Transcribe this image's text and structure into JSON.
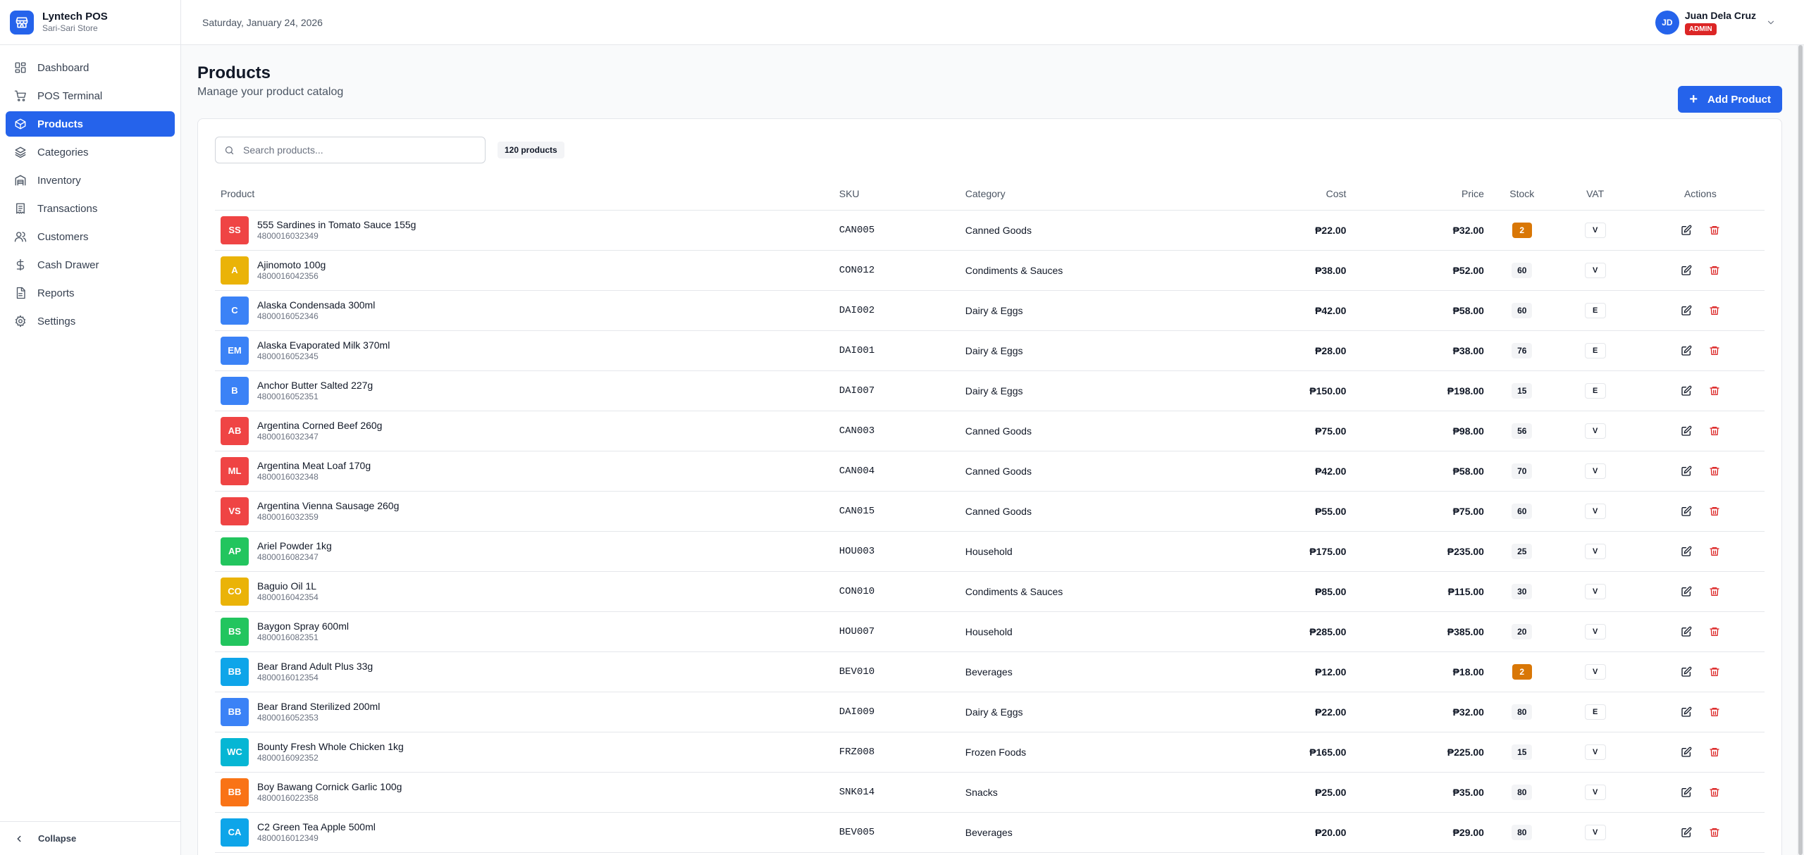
{
  "app": {
    "name": "Lyntech POS",
    "store": "Sari-Sari Store"
  },
  "header": {
    "date": "Saturday, January 24, 2026",
    "user": {
      "initials": "JD",
      "name": "Juan Dela Cruz",
      "role": "ADMIN"
    }
  },
  "sidebar": {
    "items": [
      {
        "label": "Dashboard",
        "icon": "dashboard-icon",
        "active": false
      },
      {
        "label": "POS Terminal",
        "icon": "cart-icon",
        "active": false
      },
      {
        "label": "Products",
        "icon": "package-icon",
        "active": true
      },
      {
        "label": "Categories",
        "icon": "layers-icon",
        "active": false
      },
      {
        "label": "Inventory",
        "icon": "warehouse-icon",
        "active": false
      },
      {
        "label": "Transactions",
        "icon": "receipt-icon",
        "active": false
      },
      {
        "label": "Customers",
        "icon": "users-icon",
        "active": false
      },
      {
        "label": "Cash Drawer",
        "icon": "dollar-icon",
        "active": false
      },
      {
        "label": "Reports",
        "icon": "report-icon",
        "active": false
      },
      {
        "label": "Settings",
        "icon": "gear-icon",
        "active": false
      }
    ],
    "collapse_label": "Collapse"
  },
  "page": {
    "title": "Products",
    "subtitle": "Manage your product catalog",
    "add_button": "Add Product"
  },
  "search": {
    "placeholder": "Search products..."
  },
  "product_count": "120 products",
  "table": {
    "columns": [
      "Product",
      "SKU",
      "Category",
      "Cost",
      "Price",
      "Stock",
      "VAT",
      "Actions"
    ],
    "rows": [
      {
        "initials": "SS",
        "color": "#ef4444",
        "name": "555 Sardines in Tomato Sauce 155g",
        "barcode": "4800016032349",
        "sku": "CAN005",
        "category": "Canned Goods",
        "cost": "₱22.00",
        "price": "₱32.00",
        "stock": "2",
        "low": true,
        "vat": "V"
      },
      {
        "initials": "A",
        "color": "#eab308",
        "name": "Ajinomoto 100g",
        "barcode": "4800016042356",
        "sku": "CON012",
        "category": "Condiments & Sauces",
        "cost": "₱38.00",
        "price": "₱52.00",
        "stock": "60",
        "low": false,
        "vat": "V"
      },
      {
        "initials": "C",
        "color": "#3b82f6",
        "name": "Alaska Condensada 300ml",
        "barcode": "4800016052346",
        "sku": "DAI002",
        "category": "Dairy & Eggs",
        "cost": "₱42.00",
        "price": "₱58.00",
        "stock": "60",
        "low": false,
        "vat": "E"
      },
      {
        "initials": "EM",
        "color": "#3b82f6",
        "name": "Alaska Evaporated Milk 370ml",
        "barcode": "4800016052345",
        "sku": "DAI001",
        "category": "Dairy & Eggs",
        "cost": "₱28.00",
        "price": "₱38.00",
        "stock": "76",
        "low": false,
        "vat": "E"
      },
      {
        "initials": "B",
        "color": "#3b82f6",
        "name": "Anchor Butter Salted 227g",
        "barcode": "4800016052351",
        "sku": "DAI007",
        "category": "Dairy & Eggs",
        "cost": "₱150.00",
        "price": "₱198.00",
        "stock": "15",
        "low": false,
        "vat": "E"
      },
      {
        "initials": "AB",
        "color": "#ef4444",
        "name": "Argentina Corned Beef 260g",
        "barcode": "4800016032347",
        "sku": "CAN003",
        "category": "Canned Goods",
        "cost": "₱75.00",
        "price": "₱98.00",
        "stock": "56",
        "low": false,
        "vat": "V"
      },
      {
        "initials": "ML",
        "color": "#ef4444",
        "name": "Argentina Meat Loaf 170g",
        "barcode": "4800016032348",
        "sku": "CAN004",
        "category": "Canned Goods",
        "cost": "₱42.00",
        "price": "₱58.00",
        "stock": "70",
        "low": false,
        "vat": "V"
      },
      {
        "initials": "VS",
        "color": "#ef4444",
        "name": "Argentina Vienna Sausage 260g",
        "barcode": "4800016032359",
        "sku": "CAN015",
        "category": "Canned Goods",
        "cost": "₱55.00",
        "price": "₱75.00",
        "stock": "60",
        "low": false,
        "vat": "V"
      },
      {
        "initials": "AP",
        "color": "#22c55e",
        "name": "Ariel Powder 1kg",
        "barcode": "4800016082347",
        "sku": "HOU003",
        "category": "Household",
        "cost": "₱175.00",
        "price": "₱235.00",
        "stock": "25",
        "low": false,
        "vat": "V"
      },
      {
        "initials": "CO",
        "color": "#eab308",
        "name": "Baguio Oil 1L",
        "barcode": "4800016042354",
        "sku": "CON010",
        "category": "Condiments & Sauces",
        "cost": "₱85.00",
        "price": "₱115.00",
        "stock": "30",
        "low": false,
        "vat": "V"
      },
      {
        "initials": "BS",
        "color": "#22c55e",
        "name": "Baygon Spray 600ml",
        "barcode": "4800016082351",
        "sku": "HOU007",
        "category": "Household",
        "cost": "₱285.00",
        "price": "₱385.00",
        "stock": "20",
        "low": false,
        "vat": "V"
      },
      {
        "initials": "BB",
        "color": "#0ea5e9",
        "name": "Bear Brand Adult Plus 33g",
        "barcode": "4800016012354",
        "sku": "BEV010",
        "category": "Beverages",
        "cost": "₱12.00",
        "price": "₱18.00",
        "stock": "2",
        "low": true,
        "vat": "V"
      },
      {
        "initials": "BB",
        "color": "#3b82f6",
        "name": "Bear Brand Sterilized 200ml",
        "barcode": "4800016052353",
        "sku": "DAI009",
        "category": "Dairy & Eggs",
        "cost": "₱22.00",
        "price": "₱32.00",
        "stock": "80",
        "low": false,
        "vat": "E"
      },
      {
        "initials": "WC",
        "color": "#06b6d4",
        "name": "Bounty Fresh Whole Chicken 1kg",
        "barcode": "4800016092352",
        "sku": "FRZ008",
        "category": "Frozen Foods",
        "cost": "₱165.00",
        "price": "₱225.00",
        "stock": "15",
        "low": false,
        "vat": "V"
      },
      {
        "initials": "BB",
        "color": "#f97316",
        "name": "Boy Bawang Cornick Garlic 100g",
        "barcode": "4800016022358",
        "sku": "SNK014",
        "category": "Snacks",
        "cost": "₱25.00",
        "price": "₱35.00",
        "stock": "80",
        "low": false,
        "vat": "V"
      },
      {
        "initials": "CA",
        "color": "#0ea5e9",
        "name": "C2 Green Tea Apple 500ml",
        "barcode": "4800016012349",
        "sku": "BEV005",
        "category": "Beverages",
        "cost": "₱20.00",
        "price": "₱29.00",
        "stock": "80",
        "low": false,
        "vat": "V"
      }
    ]
  }
}
